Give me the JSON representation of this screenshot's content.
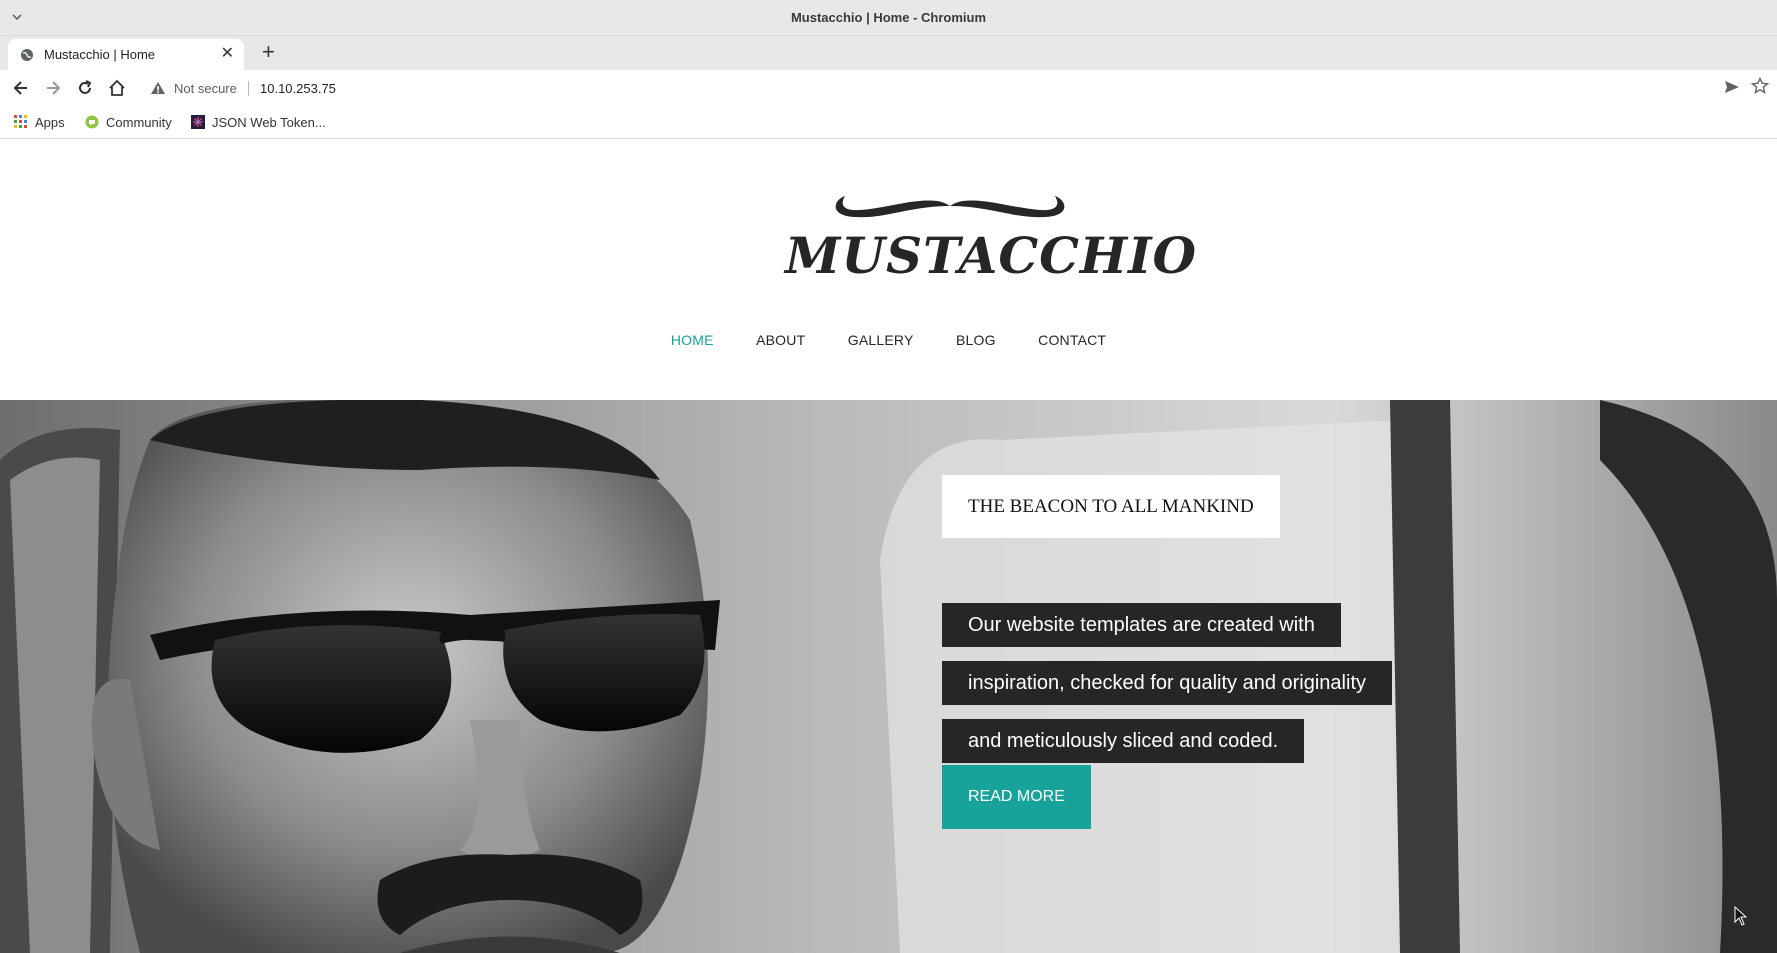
{
  "window": {
    "title": "Mustacchio | Home - Chromium"
  },
  "tabs": [
    {
      "title": "Mustacchio | Home"
    }
  ],
  "address_bar": {
    "security_label": "Not secure",
    "url": "10.10.253.75"
  },
  "bookmarks": [
    {
      "label": "Apps",
      "icon": "apps-grid-icon"
    },
    {
      "label": "Community",
      "icon": "community-icon"
    },
    {
      "label": "JSON Web Token...",
      "icon": "jwt-icon"
    }
  ],
  "site": {
    "logo_text": "MUSTACCHIO",
    "nav": [
      "HOME",
      "ABOUT",
      "GALLERY",
      "BLOG",
      "CONTACT"
    ],
    "active_nav": "HOME",
    "accent_color": "#17a39a"
  },
  "hero": {
    "heading": "THE BEACON TO ALL MANKIND",
    "lines": [
      "Our website templates are created with",
      "inspiration, checked for quality and originality",
      "and meticulously sliced and coded."
    ],
    "button_label": "READ MORE"
  }
}
